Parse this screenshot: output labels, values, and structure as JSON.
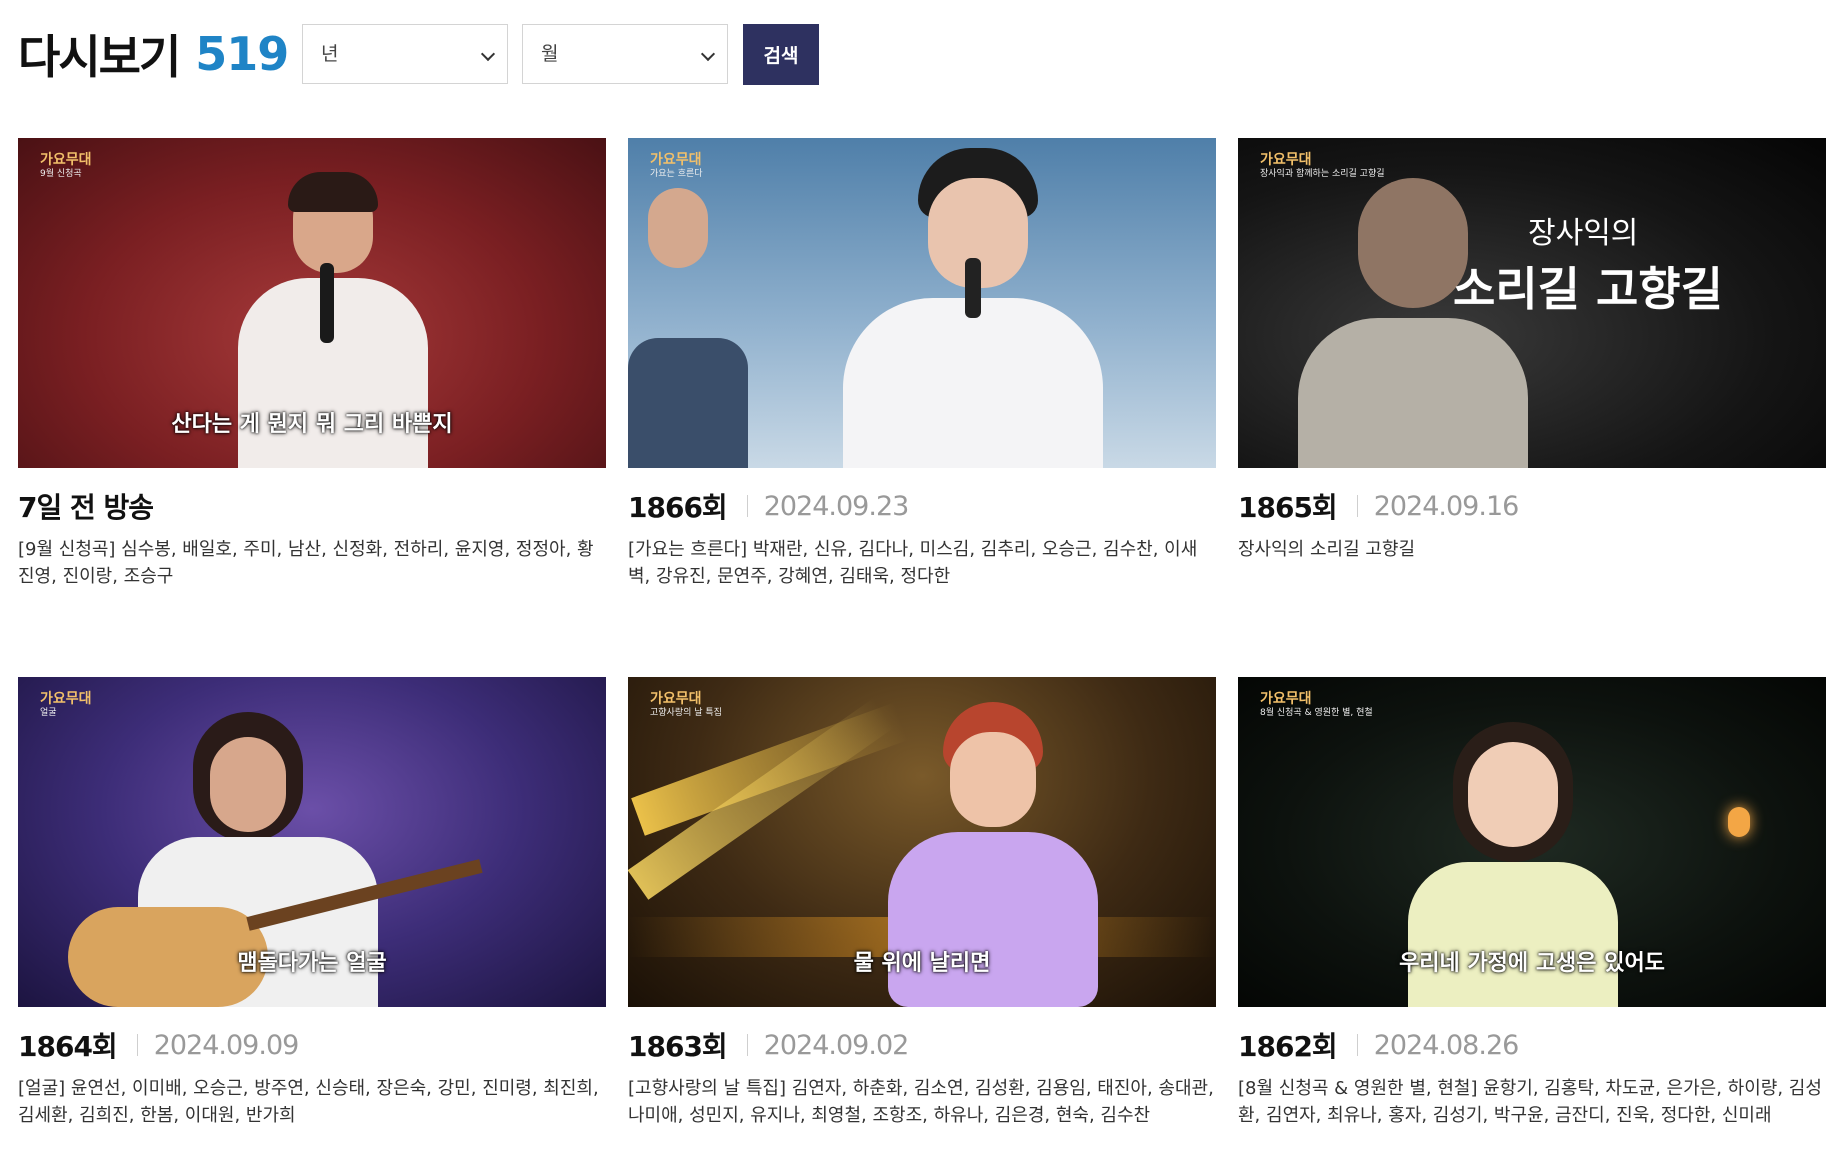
{
  "header": {
    "title": "다시보기",
    "count": "519"
  },
  "filters": {
    "year": {
      "value": "년"
    },
    "month": {
      "value": "월"
    },
    "search_label": "검색"
  },
  "episodes": [
    {
      "episode": "7일 전 방송",
      "date": "",
      "description": "[9월 신청곡] 심수봉, 배일호, 주미, 남산, 신정화, 전하리, 윤지영, 정정아, 황진영, 진이랑, 조승구",
      "caption": "산다는 게 뭔지 뭐 그리 바쁜지",
      "logo": "가요무대",
      "logo_sub": "9월 신청곡"
    },
    {
      "episode": "1866회",
      "date": "2024.09.23",
      "description": "[가요는 흐른다] 박재란, 신유, 김다나, 미스김, 김추리, 오승근, 김수찬, 이새벽, 강유진, 문연주, 강혜연, 김태욱, 정다한",
      "caption": "",
      "logo": "가요무대",
      "logo_sub": "가요는 흐른다"
    },
    {
      "episode": "1865회",
      "date": "2024.09.16",
      "description": "장사익의 소리길 고향길",
      "caption": "",
      "logo": "가요무대",
      "logo_sub": "장사익과 함께하는 소리길 고향길",
      "title_small": "장사익의",
      "title_big": "소리길 고향길"
    },
    {
      "episode": "1864회",
      "date": "2024.09.09",
      "description": "[얼굴] 윤연선, 이미배, 오승근, 방주연, 신승태, 장은숙, 강민, 진미령, 최진희, 김세환, 김희진, 한봄, 이대원, 반가희",
      "caption": "맴돌다가는 얼굴",
      "logo": "가요무대",
      "logo_sub": "얼굴"
    },
    {
      "episode": "1863회",
      "date": "2024.09.02",
      "description": "[고향사랑의 날 특집] 김연자, 하춘화, 김소연, 김성환, 김용임, 태진아, 송대관, 나미애, 성민지, 유지나, 최영철, 조항조, 하유나, 김은경, 현숙, 김수찬",
      "caption": "물 위에 날리면",
      "logo": "가요무대",
      "logo_sub": "고향사랑의 날 특집"
    },
    {
      "episode": "1862회",
      "date": "2024.08.26",
      "description": "[8월 신청곡 & 영원한 별, 현철] 윤항기, 김홍탁, 차도균, 은가은, 하이량, 김성환, 김연자, 최유나, 홍자, 김성기, 박구윤, 금잔디, 진욱, 정다한, 신미래",
      "caption": "우리네 가정에 고생은 있어도",
      "logo": "가요무대",
      "logo_sub": "8월 신청곡 & 영원한 별, 현철"
    }
  ]
}
